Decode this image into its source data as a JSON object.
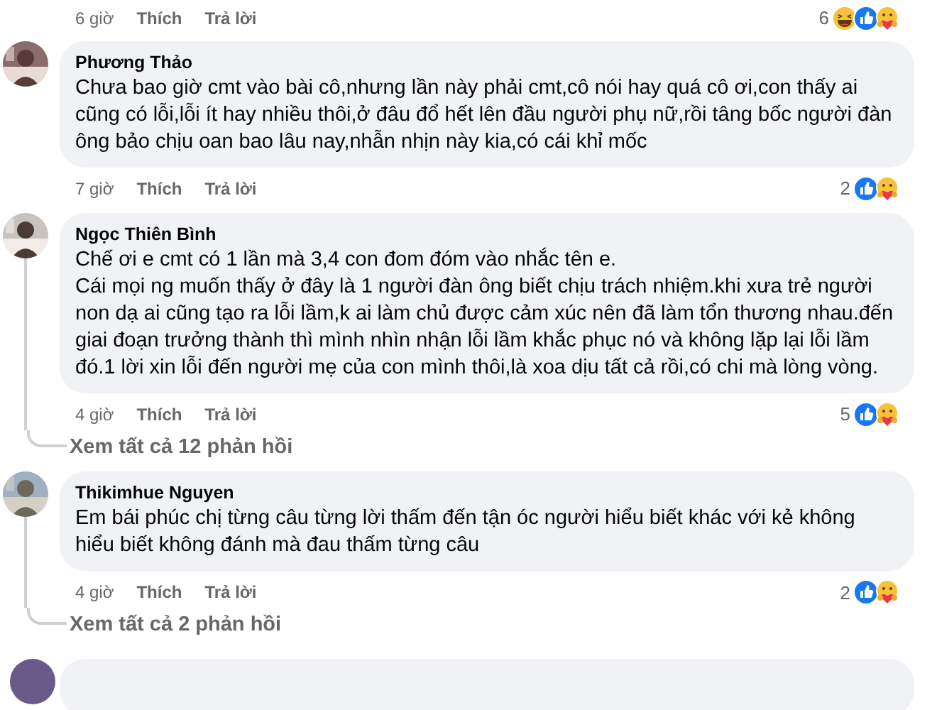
{
  "top_comment": {
    "time": "6 giờ",
    "like_label": "Thích",
    "reply_label": "Trả lời",
    "reaction_count": "6",
    "reactions": [
      {
        "kind": "haha"
      },
      {
        "kind": "like"
      },
      {
        "kind": "care"
      }
    ]
  },
  "comments": [
    {
      "author": "Phương Thảo",
      "text": "Chưa bao giờ cmt vào bài cô,nhưng lần này phải cmt,cô nói hay quá cô ơi,con thấy ai cũng có lỗi,lỗi ít hay nhiều thôi,ở đâu đổ hết lên đầu người phụ nữ,rồi tâng bốc người đàn ông bảo chịu oan bao lâu nay,nhẫn nhịn này kia,có cái khỉ mốc",
      "time": "7 giờ",
      "like_label": "Thích",
      "reply_label": "Trả lời",
      "reaction_count": "2",
      "reactions": [
        {
          "kind": "like"
        },
        {
          "kind": "care"
        }
      ]
    },
    {
      "author": "Ngọc Thiên Bình",
      "text": "Chế ơi e cmt có 1 lần mà 3,4 con đom đóm vào nhắc tên e.\nCái mọi ng muốn thấy ở đây là 1 người đàn ông biết chịu trách nhiệm.khi xưa trẻ người non dạ ai cũng tạo ra lỗi lầm,k ai làm chủ được cảm xúc nên đã làm tổn thương nhau.đến giai đoạn trưởng thành thì mình nhìn nhận lỗi lầm khắc phục nó và không lặp lại lỗi lầm đó.1 lời xin lỗi đến người mẹ của con mình thôi,là xoa dịu tất cả rồi,có chi mà lòng vòng.",
      "time": "4 giờ",
      "like_label": "Thích",
      "reply_label": "Trả lời",
      "reaction_count": "5",
      "reactions": [
        {
          "kind": "like"
        },
        {
          "kind": "care"
        }
      ],
      "replies_link": "Xem tất cả 12 phản hồi"
    },
    {
      "author": "Thikimhue Nguyen",
      "text": "Em bái phúc chị từng câu từng lời thấm đến tận óc người hiểu biết khác với kẻ không hiểu biết không đánh mà đau thấm từng câu",
      "time": "4 giờ",
      "like_label": "Thích",
      "reply_label": "Trả lời",
      "reaction_count": "2",
      "reactions": [
        {
          "kind": "like"
        },
        {
          "kind": "care"
        }
      ],
      "replies_link": "Xem tất cả 2 phản hồi"
    }
  ]
}
